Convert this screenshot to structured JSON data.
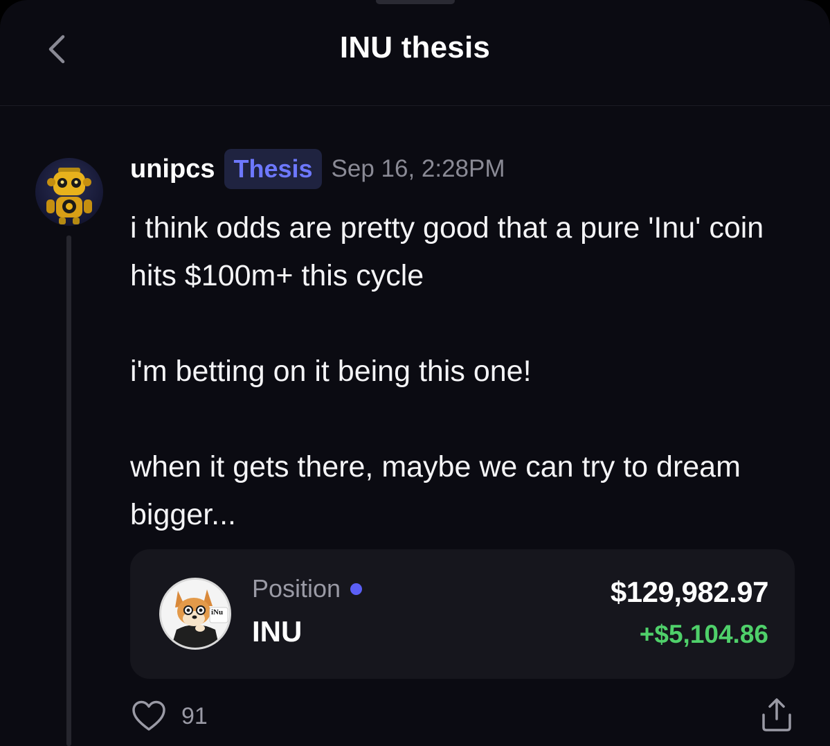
{
  "header": {
    "title": "INU thesis",
    "back_icon": "chevron-left-icon"
  },
  "post": {
    "username": "unipcs",
    "tag": "Thesis",
    "timestamp": "Sep 16, 2:28PM",
    "avatar_icon": "robot-avatar",
    "paragraphs": [
      "i think odds are pretty good that a pure 'Inu' coin hits $100m+ this cycle",
      "i'm betting on it being this one!",
      "when it gets there, maybe we can try to dream bigger..."
    ],
    "likes": "91",
    "like_icon": "heart-icon",
    "share_icon": "share-icon"
  },
  "position_card": {
    "label": "Position",
    "ticker": "INU",
    "value": "$129,982.97",
    "change": "+$5,104.86",
    "token_logo_text": "iNu",
    "colors": {
      "change": "#4fd06a",
      "dot": "#5b5ff5",
      "tag_text": "#6d78ff"
    }
  }
}
